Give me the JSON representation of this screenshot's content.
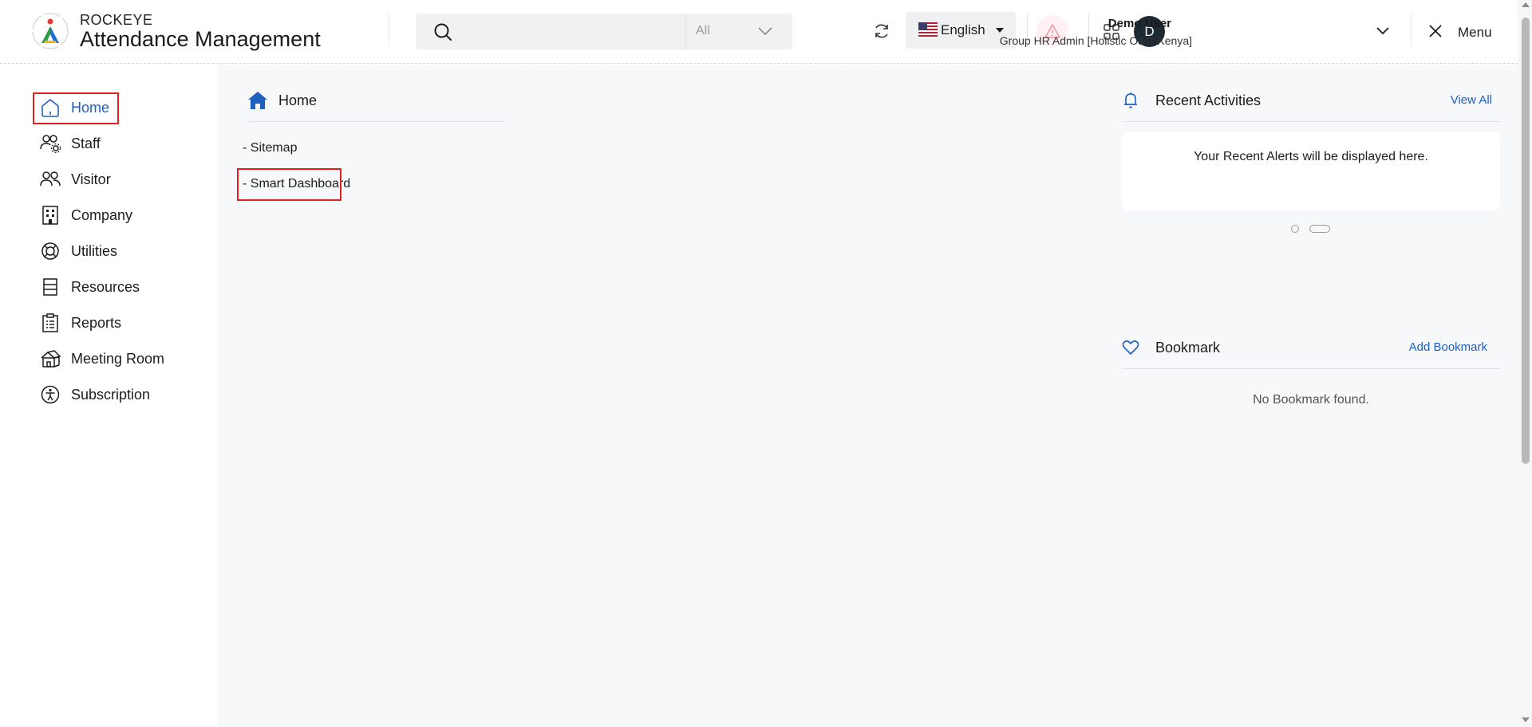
{
  "header": {
    "brand_top": "ROCKEYE",
    "brand_title": "Attendance Management",
    "search": {
      "placeholder": "",
      "scope": "All"
    },
    "language": "English",
    "user": {
      "avatar_initial": "D",
      "name": "Demo User",
      "role": "Group HR Admin [Holistic O&G Kenya]"
    },
    "menu_label": "Menu"
  },
  "sidebar": {
    "items": [
      {
        "label": "Home",
        "icon": "home-icon",
        "active": true
      },
      {
        "label": "Staff",
        "icon": "staff-icon"
      },
      {
        "label": "Visitor",
        "icon": "visitor-icon"
      },
      {
        "label": "Company",
        "icon": "company-icon"
      },
      {
        "label": "Utilities",
        "icon": "utilities-icon"
      },
      {
        "label": "Resources",
        "icon": "resources-icon"
      },
      {
        "label": "Reports",
        "icon": "reports-icon"
      },
      {
        "label": "Meeting Room",
        "icon": "meeting-room-icon"
      },
      {
        "label": "Subscription",
        "icon": "subscription-icon"
      }
    ]
  },
  "main": {
    "home": {
      "title": "Home",
      "links": [
        "- Sitemap",
        "- Smart Dashboard"
      ]
    },
    "recent_activities": {
      "title": "Recent Activities",
      "link": "View All",
      "empty_text": "Your Recent Alerts will be displayed here."
    },
    "bookmark": {
      "title": "Bookmark",
      "link": "Add Bookmark",
      "empty_text": "No Bookmark found."
    }
  },
  "colors": {
    "accent": "#1f5fbf",
    "highlight": "#e32020",
    "main_bg": "#f7f8fa",
    "avatar_bg": "#1e2a33"
  }
}
